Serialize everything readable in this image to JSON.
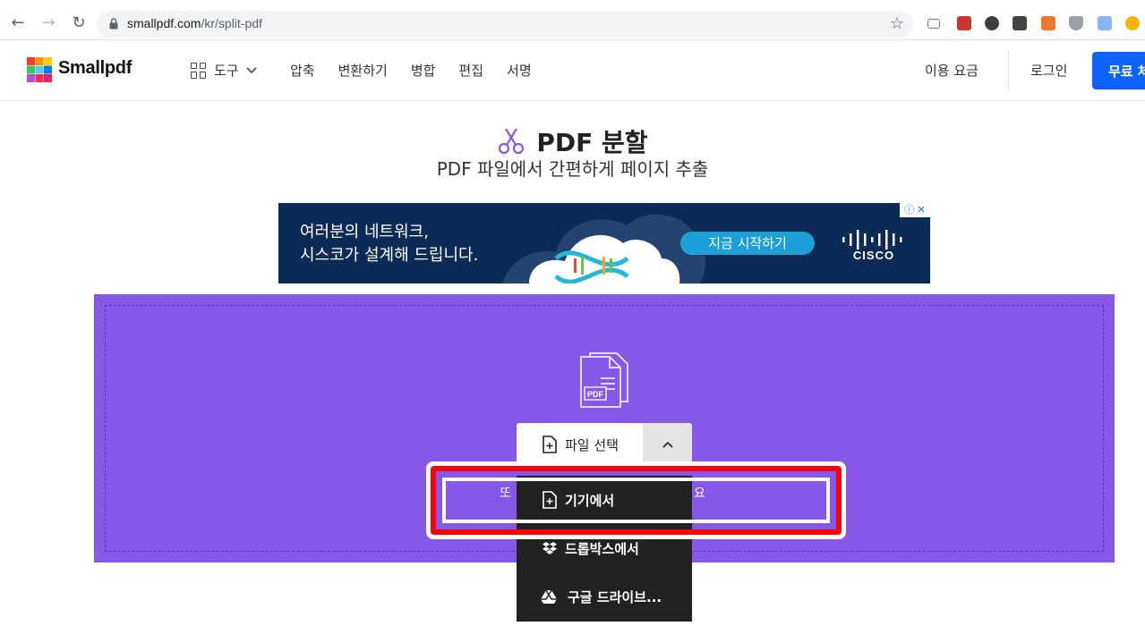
{
  "browser": {
    "url_host": "smallpdf.com",
    "url_path": "/kr/split-pdf"
  },
  "header": {
    "logo_text": "Smallpdf",
    "tools_label": "도구",
    "nav": [
      "압축",
      "변환하기",
      "병합",
      "편집",
      "서명"
    ],
    "pricing": "이용 요금",
    "login": "로그인",
    "trial_button": "무료 체"
  },
  "page": {
    "title": "PDF 분할",
    "subtitle": "PDF 파일에서 간편하게 페이지 추출"
  },
  "ad": {
    "line1": "여러분의 네트워크,",
    "line2": "시스코가 설계해 드립니다.",
    "cta": "지금 시작하기",
    "brand": "CISCO"
  },
  "upload": {
    "choose_file": "파일 선택",
    "hint_left": "또",
    "hint_right": "요",
    "menu": [
      "기기에서",
      "드롭박스에서",
      "구글 드라이브..."
    ]
  },
  "colors": {
    "dropzone": "#8558e8",
    "accent_blue": "#0b62ff",
    "highlight": "#ff0000"
  }
}
